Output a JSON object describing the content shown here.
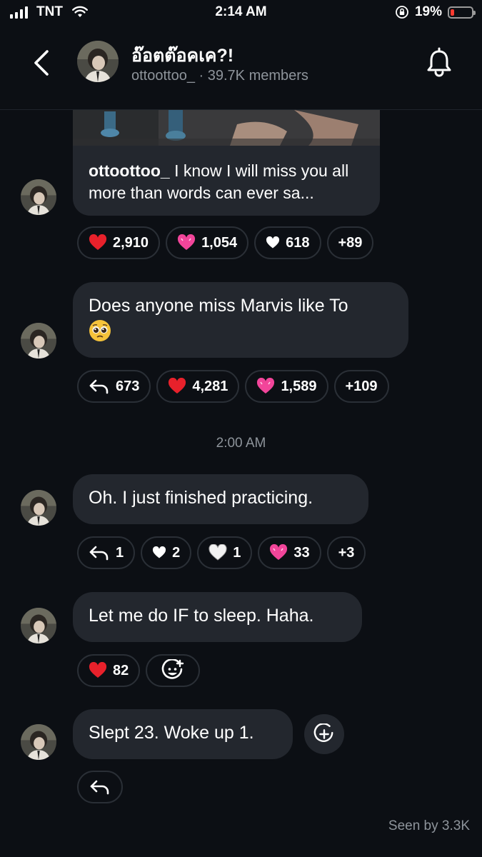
{
  "status_bar": {
    "carrier": "TNT",
    "time": "2:14 AM",
    "battery": "19%",
    "battery_level": 0.19
  },
  "header": {
    "title": "อ๊อตต๊อคเค?!",
    "username": "ottoottoo_",
    "members": "· 39.7K members"
  },
  "messages": [
    {
      "id": "m1",
      "caption_user": "ottoottoo_",
      "caption_text": " I know I will miss you all more than words can ever sa...",
      "reactions": [
        {
          "icon": "red-heart-icon",
          "count": "2,910"
        },
        {
          "icon": "pink-heart-icon",
          "count": "1,054"
        },
        {
          "icon": "white-heart-icon",
          "count": "618"
        },
        {
          "icon": "",
          "count": "+89"
        }
      ]
    },
    {
      "id": "m2",
      "text": "Does anyone miss Marvis like To",
      "reactions": [
        {
          "icon": "reply-icon",
          "count": "673"
        },
        {
          "icon": "red-heart-icon",
          "count": "4,281"
        },
        {
          "icon": "pink-heart-icon",
          "count": "1,589"
        },
        {
          "icon": "",
          "count": "+109"
        }
      ]
    },
    {
      "id": "m3",
      "text": "Oh. I just finished practicing.",
      "reactions": [
        {
          "icon": "reply-icon",
          "count": "1"
        },
        {
          "icon": "white-heart-icon",
          "count": "2"
        },
        {
          "icon": "white-outline-heart-icon",
          "count": "1"
        },
        {
          "icon": "pink-heart-icon",
          "count": "33"
        },
        {
          "icon": "",
          "count": "+3"
        }
      ]
    },
    {
      "id": "m4",
      "text": "Let me do IF to sleep. Haha.",
      "reactions": [
        {
          "icon": "red-heart-icon",
          "count": "82"
        },
        {
          "icon": "add-reaction-icon",
          "count": ""
        }
      ]
    },
    {
      "id": "m5",
      "text": "Slept 23. Woke up 1.",
      "reactions": [
        {
          "icon": "reply-icon",
          "count": ""
        }
      ]
    }
  ],
  "time_separator": "2:00 AM",
  "seen_by": "Seen by 3.3K",
  "colors": {
    "background": "#0c0f14",
    "bubble": "#23272e",
    "muted_text": "#8e949b",
    "red_heart": "#e8212b",
    "pink_heart": "#f2459a"
  }
}
